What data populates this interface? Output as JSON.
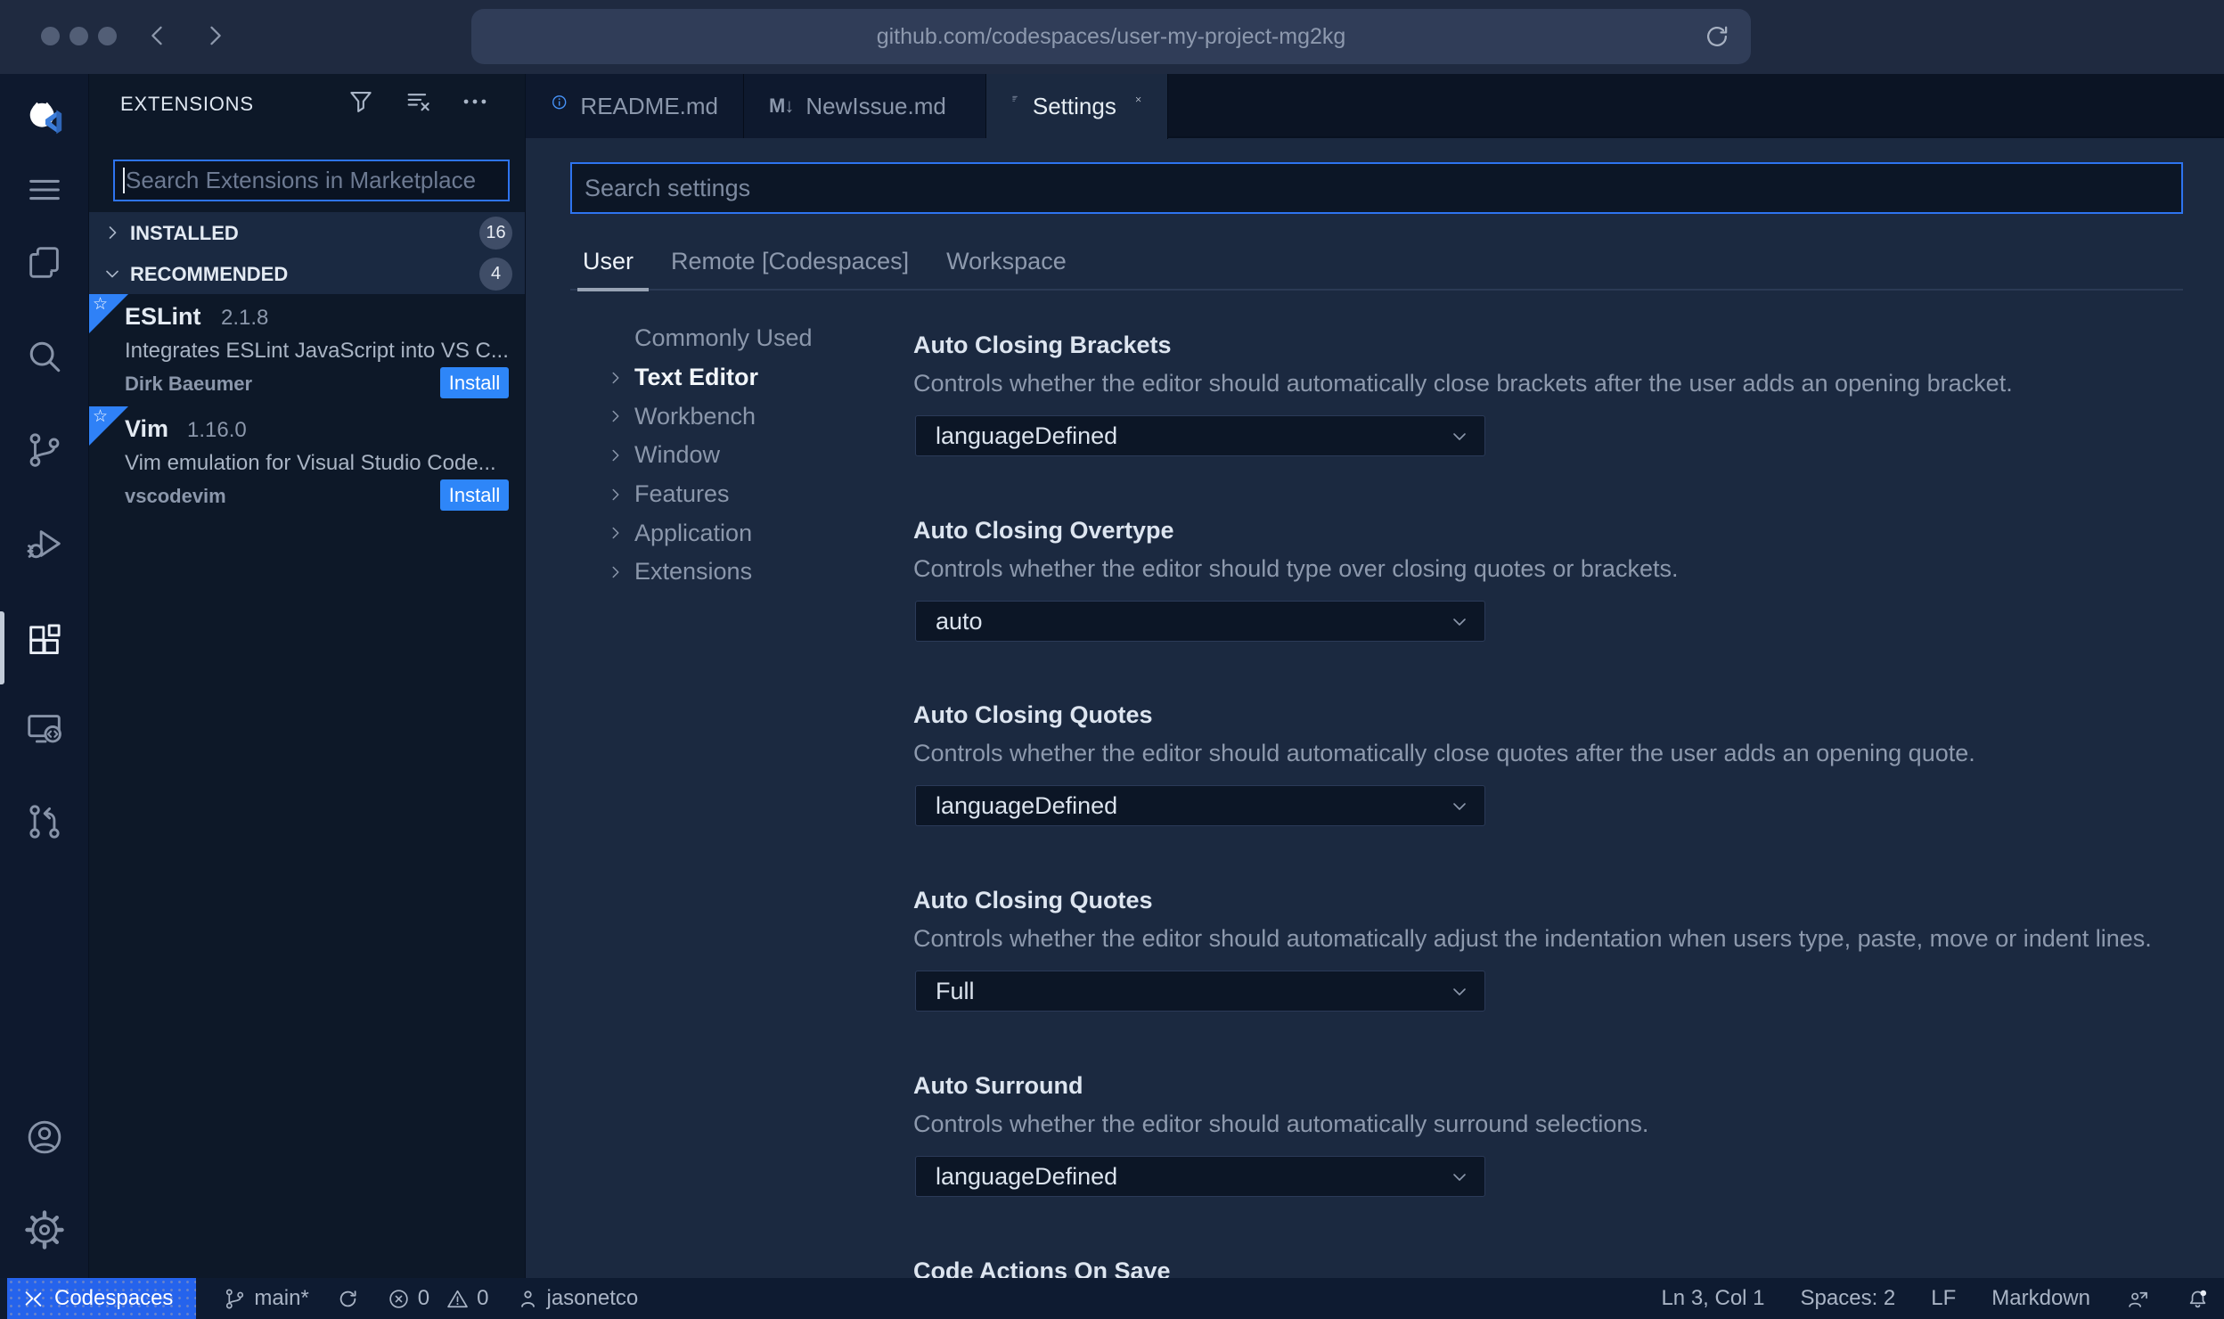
{
  "browser": {
    "url": "github.com/codespaces/user-my-project-mg2kg"
  },
  "icons": {
    "star": "☆",
    "markdown_tab": "M↓"
  },
  "sidebar": {
    "title": "EXTENSIONS",
    "search_placeholder": "Search Extensions in Marketplace",
    "sections": [
      {
        "label": "INSTALLED",
        "count": "16"
      },
      {
        "label": "RECOMMENDED",
        "count": "4"
      }
    ],
    "extensions": [
      {
        "name": "ESLint",
        "version": "2.1.8",
        "description": "Integrates ESLint JavaScript into VS C...",
        "author": "Dirk Baeumer",
        "action": "Install"
      },
      {
        "name": "Vim",
        "version": "1.16.0",
        "description": "Vim emulation for Visual Studio Code...",
        "author": "vscodevim",
        "action": "Install"
      }
    ]
  },
  "editor": {
    "tabs": [
      {
        "label": "README.md"
      },
      {
        "label": "NewIssue.md"
      },
      {
        "label": "Settings"
      }
    ],
    "settings": {
      "search_placeholder": "Search settings",
      "scopes": [
        {
          "label": "User"
        },
        {
          "label": "Remote [Codespaces]"
        },
        {
          "label": "Workspace"
        }
      ],
      "toc": [
        {
          "label": "Commonly Used"
        },
        {
          "label": "Text Editor"
        },
        {
          "label": "Workbench"
        },
        {
          "label": "Window"
        },
        {
          "label": "Features"
        },
        {
          "label": "Application"
        },
        {
          "label": "Extensions"
        }
      ],
      "items": [
        {
          "title": "Auto Closing Brackets",
          "description": "Controls whether the editor should automatically close brackets after the user adds an opening bracket.",
          "value": "languageDefined"
        },
        {
          "title": "Auto Closing Overtype",
          "description": "Controls whether the editor should type over closing quotes or brackets.",
          "value": "auto"
        },
        {
          "title": "Auto Closing Quotes",
          "description": "Controls whether the editor should automatically close quotes after the user adds an opening quote.",
          "value": "languageDefined"
        },
        {
          "title": "Auto Closing Quotes",
          "description": "Controls whether the editor should automatically adjust the indentation when users type, paste, move or indent lines.",
          "value": "Full"
        },
        {
          "title": "Auto Surround",
          "description": "Controls whether the editor should automatically surround selections.",
          "value": "languageDefined"
        },
        {
          "title": "Code Actions On Save"
        }
      ]
    }
  },
  "status_bar": {
    "codespaces": "Codespaces",
    "branch": "main*",
    "errors": "0",
    "warnings": "0",
    "user": "jasonetco",
    "line_col": "Ln 3, Col 1",
    "spaces": "Spaces: 2",
    "eol": "LF",
    "language": "Markdown"
  },
  "colors": {
    "accent": "#2f81f7",
    "install_blue": "#2e86f8",
    "codespaces_blue": "#2563ec"
  }
}
